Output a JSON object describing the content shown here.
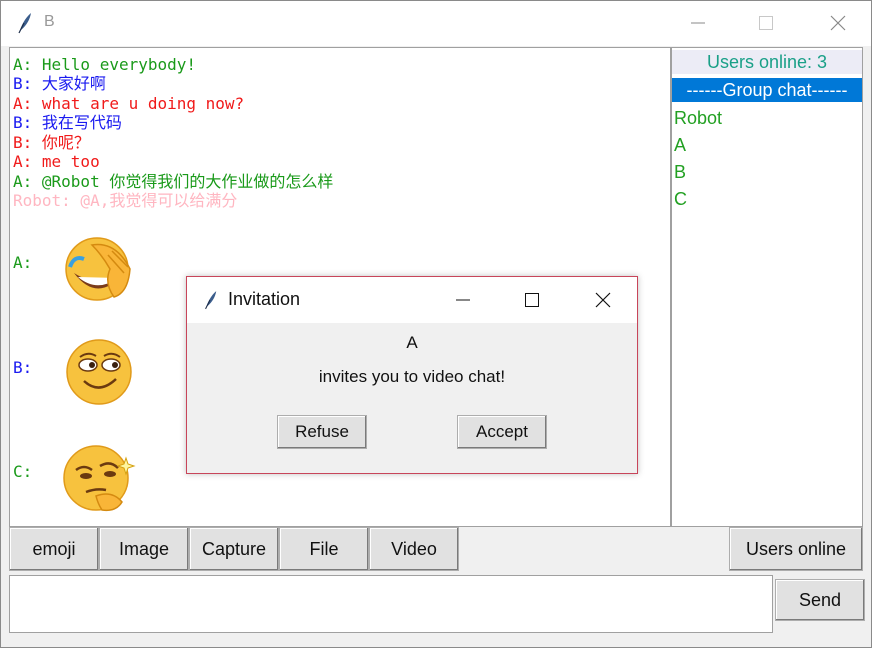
{
  "window": {
    "title": "B",
    "controls": [
      "minimize-icon",
      "maximize-icon",
      "close-icon"
    ]
  },
  "chat": {
    "messages": [
      {
        "text": "A: Hello everybody!",
        "color": "#1a9a1a"
      },
      {
        "text": "B: 大家好啊",
        "color": "#1a1af0"
      },
      {
        "text": "A: what are u doing now?",
        "color": "#f01a1a",
        "note": "sender color differs"
      },
      {
        "text": "B: 我在写代码",
        "color": "#1a1af0"
      },
      {
        "text": "B: 你呢？",
        "color": "#f01a1a"
      },
      {
        "text": "A: me too",
        "color": "#f01a1a"
      },
      {
        "text": "A: @Robot 你觉得我们的大作业做的怎么样",
        "color": "#1a9a1a"
      },
      {
        "text": "Robot: @A,我觉得可以给满分",
        "color": "#ffb6c1"
      }
    ],
    "emoji_messages": [
      {
        "label": "A:",
        "emoji": "facepalm-laughing-emoji",
        "color": "#1a9a1a"
      },
      {
        "label": "B:",
        "emoji": "smug-grin-emoji",
        "color": "#1a1af0"
      },
      {
        "label": "C:",
        "emoji": "thinking-sparkle-emoji",
        "color": "#1a9a1a"
      }
    ]
  },
  "users_panel": {
    "header": "Users online: 3",
    "selected": "------Group chat------",
    "users": [
      "Robot",
      "A",
      "B",
      "C"
    ]
  },
  "toolbar": {
    "buttons": [
      "emoji",
      "Image",
      "Capture",
      "File",
      "Video"
    ],
    "users_online_label": "Users online"
  },
  "input": {
    "value": "",
    "send_label": "Send"
  },
  "dialog": {
    "title": "Invitation",
    "from": "A",
    "message": "invites you to video chat!",
    "refuse_label": "Refuse",
    "accept_label": "Accept"
  },
  "colors": {
    "accent_blue": "#0078d7",
    "dialog_border": "#c8455a"
  }
}
